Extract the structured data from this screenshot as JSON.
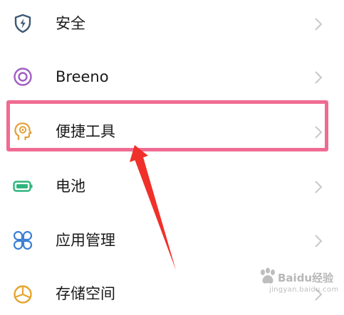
{
  "settings_list": {
    "items": [
      {
        "label": "安全",
        "icon": "shield-bolt-icon",
        "color": "#3d5a73"
      },
      {
        "label": "Breeno",
        "icon": "breeno-ring-icon",
        "color": "#a15ec3"
      },
      {
        "label": "便捷工具",
        "icon": "head-gear-icon",
        "color": "#e2a23a"
      },
      {
        "label": "电池",
        "icon": "battery-icon",
        "color": "#2fb57c"
      },
      {
        "label": "应用管理",
        "icon": "apps-clover-icon",
        "color": "#3b7fd6"
      },
      {
        "label": "存储空间",
        "icon": "storage-pie-icon",
        "color": "#e5a52f"
      }
    ]
  },
  "annotation": {
    "highlight_color": "#f06b93",
    "arrow_color": "#f0302a"
  },
  "watermark": {
    "text": "Baidu经验",
    "subtext": "jingyan.baidu.com"
  }
}
